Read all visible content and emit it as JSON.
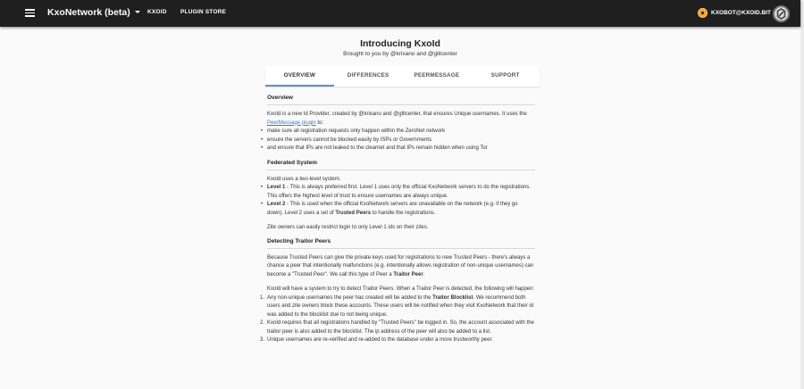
{
  "topbar": {
    "app_title": "KxoNetwork (beta)",
    "nav_links": [
      "KXOID",
      "PLUGIN STORE"
    ],
    "account_label": "KXOBOT@KXOID.BIT"
  },
  "header": {
    "title": "Introducing KxoId",
    "subtitle": "Brought to you by @krixano and @glitcenter"
  },
  "tabs": [
    "OVERVIEW",
    "DIFFERENCES",
    "PEERMESSAGE",
    "SUPPORT"
  ],
  "overview": {
    "title": "Overview",
    "intro_before_link": "KxoId is a new Id Provider, created by @krixano and @glitcenter, that ensures Unique usernames. It uses the ",
    "intro_link": "PeerMessage plugin",
    "intro_after_link": " to:",
    "bullets": [
      "make sure all registration requests only happen within the ZeroNet network",
      "ensure the servers cannot be blocked easily by ISPs or Governments",
      "and ensure that IPs are not leaked to the clearnet and that IPs remain hidden when using Tor"
    ]
  },
  "federated": {
    "title": "Federated System",
    "intro": "KxoId uses a two-level system.",
    "level1_label": "Level 1",
    "level1_text": " - This is always preferred first. Level 1 uses only the official KxoNetwork servers to do the registrations. This offers the highest level of trust to ensure usernames are always unique.",
    "level2_label": "Level 2",
    "level2_text_a": " - This is used when the official KxoNetwork servers are unavailable on the network (e.g. if they go down). Level 2 uses a set of ",
    "level2_bold": "Trusted Peers",
    "level2_text_b": " to handle the registrations.",
    "footer": "Zite owners can easily restrict login to only Level 1 ids on their zites."
  },
  "traitor": {
    "title": "Detecting Traitor Peers",
    "para1_a": "Because Trusted Peers can give the private keys used for registrations to new Trusted Peers - there's always a chance a peer that intentionally malfunctions (e.g. intentionally allows registration of non-unique usernames) can become a \"Trusted Peer\". We call this type of Peer a ",
    "para1_bold": "Traitor Peer",
    "para1_end": ".",
    "para2": "KxoId will have a system to try to detect Traitor Peers. When a Traitor Peer is detected, the following will happen:",
    "item1_a": "Any non-unique usernames the peer has created will be added to the ",
    "item1_bold": "Traitor Blocklist",
    "item1_b": ". We recommend both users and zite owners block these accounts. These users will be notified when they visit KxoNetwork that their id was added to the blocklist due to not being unique.",
    "item2": "KxoId requires that all registrations handled by \"Trusted Peers\" be logged in. So, the account associated with the traitor peer is also added to the blocklist. The ip address of the peer will also be added to a list.",
    "item3": "Unique usernames are re-verified and re-added to the database under a more trustworthy peer."
  },
  "icons": {
    "menu": "menu-icon",
    "account": "bitcoin-coin-icon",
    "logo": "zeronet-logo-icon"
  },
  "colors": {
    "topbar": "#1f1f1f",
    "accent": "#5d8fc9",
    "link": "#3a7fc8",
    "account_icon": "#f0a030"
  }
}
